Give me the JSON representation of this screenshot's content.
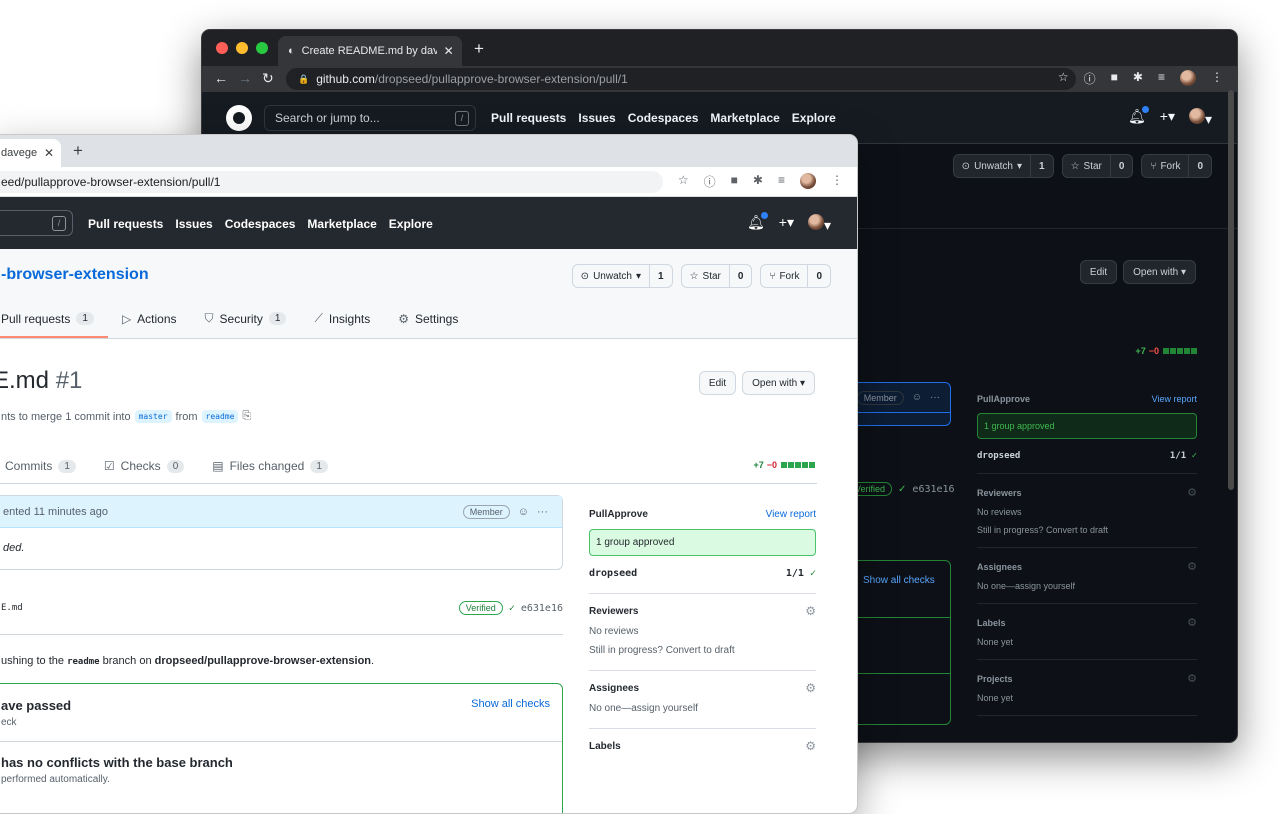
{
  "back_window": {
    "tab_title": "Create README.md by davege",
    "url_host": "github.com",
    "url_path": "/dropseed/pullapprove-browser-extension/pull/1",
    "search_placeholder": "Search or jump to...",
    "search_key": "/",
    "nav": [
      "Pull requests",
      "Issues",
      "Codespaces",
      "Marketplace",
      "Explore"
    ],
    "unwatch": "Unwatch",
    "unwatch_count": "1",
    "star": "Star",
    "star_count": "0",
    "fork": "Fork",
    "fork_count": "0",
    "edit": "Edit",
    "open_with": "Open with",
    "diff_add": "+7",
    "diff_del": "−0",
    "member": "Member",
    "verified": "Verified",
    "commit_sha": "e631e16",
    "show_all_checks": "Show all checks",
    "pullapprove": "PullApprove",
    "view_report": "View report",
    "approved": "1 group approved",
    "group_name": "dropseed",
    "group_count": "1/1",
    "reviewers": "Reviewers",
    "no_reviews": "No reviews",
    "draft_hint": "Still in progress? Convert to draft",
    "assignees": "Assignees",
    "assign_hint": "No one—assign yourself",
    "labels": "Labels",
    "labels_hint": "None yet",
    "projects": "Projects",
    "projects_hint": "None yet"
  },
  "front_window": {
    "tab_title": "davege",
    "url_path": "eed/pullapprove-browser-extension/pull/1",
    "search_key": "/",
    "nav": [
      "Pull requests",
      "Issues",
      "Codespaces",
      "Marketplace",
      "Explore"
    ],
    "repo_name": "-browser-extension",
    "unwatch": "Unwatch",
    "unwatch_count": "1",
    "star": "Star",
    "star_count": "0",
    "fork": "Fork",
    "fork_count": "0",
    "repo_tabs": [
      {
        "label": "Pull requests",
        "count": "1"
      },
      {
        "label": "Actions",
        "count": ""
      },
      {
        "label": "Security",
        "count": "1"
      },
      {
        "label": "Insights",
        "count": ""
      },
      {
        "label": "Settings",
        "count": ""
      }
    ],
    "pr_title": "E.md",
    "pr_number": "#1",
    "edit": "Edit",
    "open_with": "Open with",
    "meta_text": "nts to merge 1 commit into",
    "base_branch": "master",
    "from_word": "from",
    "head_branch": "readme",
    "pr_tabs": [
      {
        "label": "Commits",
        "count": "1"
      },
      {
        "label": "Checks",
        "count": "0"
      },
      {
        "label": "Files changed",
        "count": "1"
      }
    ],
    "diff_add": "+7",
    "diff_del": "−0",
    "comment_header": "ented 11 minutes ago",
    "member": "Member",
    "comment_body": "ded.",
    "commit_file": "E.md",
    "verified": "Verified",
    "commit_sha": "e631e16",
    "push_prefix": "ushing to the",
    "push_branch": "readme",
    "push_mid": "branch on",
    "push_repo": "dropseed/pullapprove-browser-extension",
    "push_suffix": ".",
    "checks_title": "ave passed",
    "checks_sub": "eck",
    "show_all_checks": "Show all checks",
    "conflicts_title": "has no conflicts with the base branch",
    "conflicts_sub": "performed automatically.",
    "pullapprove": "PullApprove",
    "view_report": "View report",
    "approved": "1 group approved",
    "group_name": "dropseed",
    "group_count": "1/1",
    "reviewers": "Reviewers",
    "no_reviews": "No reviews",
    "draft_hint": "Still in progress? Convert to draft",
    "assignees": "Assignees",
    "assign_hint": "No one—assign yourself",
    "labels": "Labels"
  }
}
